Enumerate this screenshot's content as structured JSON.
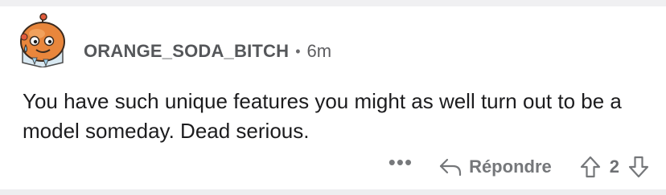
{
  "comment": {
    "username": "ORANGE_SODA_BITCH",
    "separator": "•",
    "time": "6m",
    "text": "You have such unique features you might as well turn out to be a model someday. Dead serious.",
    "more_label": "•••",
    "reply_label": "Répondre",
    "score": "2"
  },
  "icons": {
    "avatar": "snoo-avatar-orange-blob",
    "reply": "reply-arrow-icon",
    "upvote": "arrow-up-icon",
    "downvote": "arrow-down-icon"
  },
  "colors": {
    "avatar_orange": "#e8863c",
    "text": "#1c1c1e",
    "muted": "#5c5c5e"
  }
}
